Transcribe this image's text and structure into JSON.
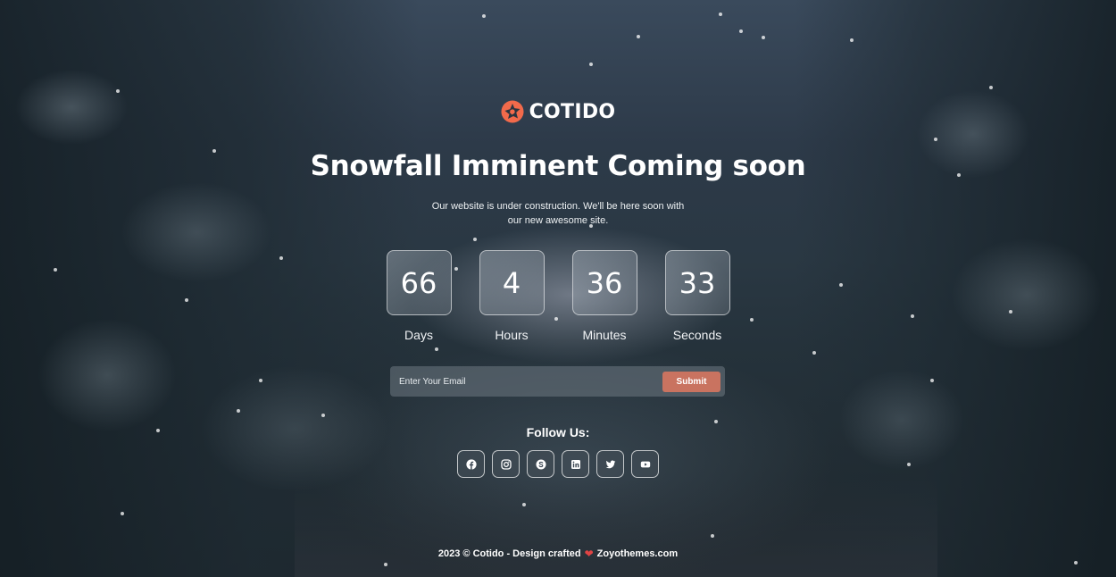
{
  "brand": {
    "name": "COTIDO",
    "accent": "#f26a4b"
  },
  "headline": "Snowfall Imminent Coming soon",
  "subtitle_line1": "Our website is under construction. We'll be here soon with",
  "subtitle_line2": "our new awesome site.",
  "countdown": [
    {
      "value": "66",
      "label": "Days"
    },
    {
      "value": "4",
      "label": "Hours"
    },
    {
      "value": "36",
      "label": "Minutes"
    },
    {
      "value": "33",
      "label": "Seconds"
    }
  ],
  "subscribe": {
    "placeholder": "Enter Your Email",
    "button_label": "Submit",
    "button_color": "#c97360"
  },
  "follow_label": "Follow Us:",
  "socials": [
    "facebook-icon",
    "instagram-icon",
    "skype-icon",
    "linkedin-icon",
    "twitter-icon",
    "youtube-icon"
  ],
  "footer": {
    "prefix": "2023 © Cotido - Design crafted",
    "heart": "❤",
    "suffix": "Zoyothemes.com"
  }
}
